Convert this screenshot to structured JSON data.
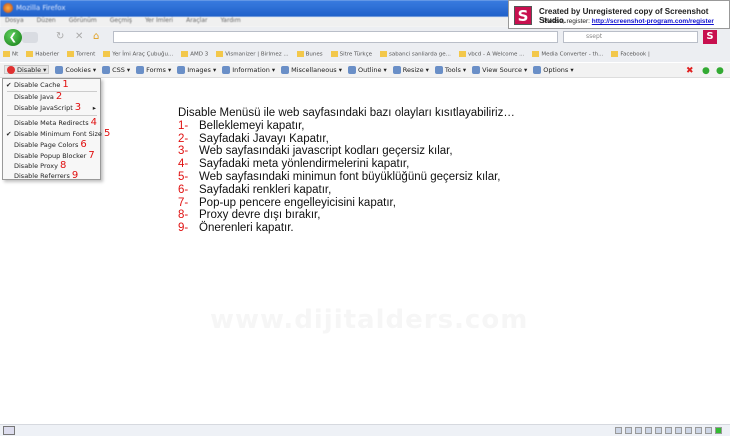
{
  "window": {
    "title": "Mozilla Firefox"
  },
  "menubar": [
    "Dosya",
    "Düzen",
    "Görünüm",
    "Geçmiş",
    "Yer İmleri",
    "Araçlar",
    "Yardım"
  ],
  "search": {
    "value": "ssept"
  },
  "bookmarks": [
    "Nt",
    "Haberler",
    "Torrent",
    "Yer İmi Araç Çubuğu...",
    "AMD 3",
    "Vismanizer | Birlmez ...",
    "Bunes",
    "Sitre Türkçe",
    "sabanci sanliarda ge...",
    "vbcd - A Welcome ...",
    "Media Converter - th...",
    "Facebook |"
  ],
  "devbar": [
    {
      "label": "Disable",
      "icon": "disable-icon"
    },
    {
      "label": "Cookies",
      "icon": "cookies-icon"
    },
    {
      "label": "CSS",
      "icon": "css-icon"
    },
    {
      "label": "Forms",
      "icon": "forms-icon"
    },
    {
      "label": "Images",
      "icon": "images-icon"
    },
    {
      "label": "Information",
      "icon": "information-icon"
    },
    {
      "label": "Miscellaneous",
      "icon": "miscellaneous-icon"
    },
    {
      "label": "Outline",
      "icon": "outline-icon"
    },
    {
      "label": "Resize",
      "icon": "resize-icon"
    },
    {
      "label": "Tools",
      "icon": "tools-icon"
    },
    {
      "label": "View Source",
      "icon": "view-source-icon"
    },
    {
      "label": "Options",
      "icon": "options-icon"
    }
  ],
  "menu": [
    {
      "label": "Disable Cache",
      "num": "1",
      "checked": true
    },
    {
      "label": "Disable Java",
      "num": "2",
      "checked": false
    },
    {
      "label": "Disable JavaScript",
      "num": "3",
      "checked": false,
      "submenu": true
    },
    {
      "label": "Disable Meta Redirects",
      "num": "4",
      "checked": false
    },
    {
      "label": "Disable Minimum Font Size",
      "num": "5",
      "checked": true
    },
    {
      "label": "Disable Page Colors",
      "num": "6",
      "checked": false
    },
    {
      "label": "Disable Popup Blocker",
      "num": "7",
      "checked": false
    },
    {
      "label": "Disable Proxy",
      "num": "8",
      "checked": false
    },
    {
      "label": "Disable Referrers",
      "num": "9",
      "checked": false
    }
  ],
  "banner": {
    "line1": "Created by Unregistered copy of Screenshot Studio.",
    "prefix": "Please, register:",
    "link": "http://screenshot-program.com/register"
  },
  "content": {
    "heading": "Disable Menüsü ile web sayfasındaki bazı olayları kısıtlayabiliriz…",
    "items": [
      {
        "n": "1-",
        "t": "Belleklemeyi kapatır,"
      },
      {
        "n": "2-",
        "t": "Sayfadaki Javayı Kapatır,"
      },
      {
        "n": "3-",
        "t": "Web sayfasındaki javascript kodları geçersiz kılar,"
      },
      {
        "n": "4-",
        "t": "Sayfadaki meta yönlendirmelerini kapatır,"
      },
      {
        "n": "5-",
        "t": "Web sayfasındaki minimun font büyüklüğünü geçersiz kılar,"
      },
      {
        "n": "6-",
        "t": "Sayfadaki renkleri kapatır,"
      },
      {
        "n": "7-",
        "t": "Pop-up pencere engelleyicisini kapatır,"
      },
      {
        "n": "8-",
        "t": "Proxy devre dışı bırakır,"
      },
      {
        "n": "9-",
        "t": "Önerenleri kapatır."
      }
    ]
  },
  "watermark": "www.dijitalders.com",
  "colors": {
    "accent_red": "#e01010",
    "titlebar": "#2a6fd6"
  }
}
